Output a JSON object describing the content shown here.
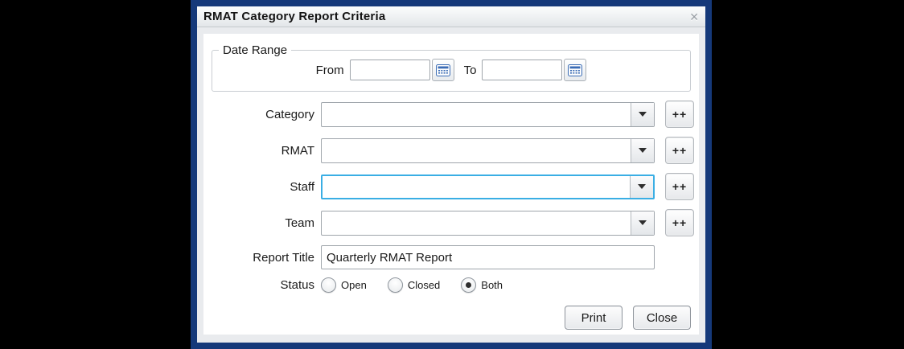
{
  "colors": {
    "backdrop": "#000000",
    "dialog_border": "#15397a",
    "focus_highlight": "#3aaee4",
    "calendar_icon_blue": "#3a6cb5"
  },
  "dialog": {
    "title": "RMAT Category Report Criteria",
    "close_glyph": "✕"
  },
  "date_range": {
    "legend": "Date Range",
    "from_label": "From",
    "from_value": "",
    "to_label": "To",
    "to_value": ""
  },
  "combo_rows": [
    {
      "label": "Category",
      "value": "",
      "add_label": "++",
      "focused": false
    },
    {
      "label": "RMAT",
      "value": "",
      "add_label": "++",
      "focused": false
    },
    {
      "label": "Staff",
      "value": "",
      "add_label": "++",
      "focused": true
    },
    {
      "label": "Team",
      "value": "",
      "add_label": "++",
      "focused": false
    }
  ],
  "report_title": {
    "label": "Report Title",
    "value": "Quarterly RMAT Report"
  },
  "status": {
    "label": "Status",
    "options": [
      {
        "label": "Open",
        "selected": false
      },
      {
        "label": "Closed",
        "selected": false
      },
      {
        "label": "Both",
        "selected": true
      }
    ]
  },
  "footer": {
    "print_label": "Print",
    "close_label": "Close"
  }
}
